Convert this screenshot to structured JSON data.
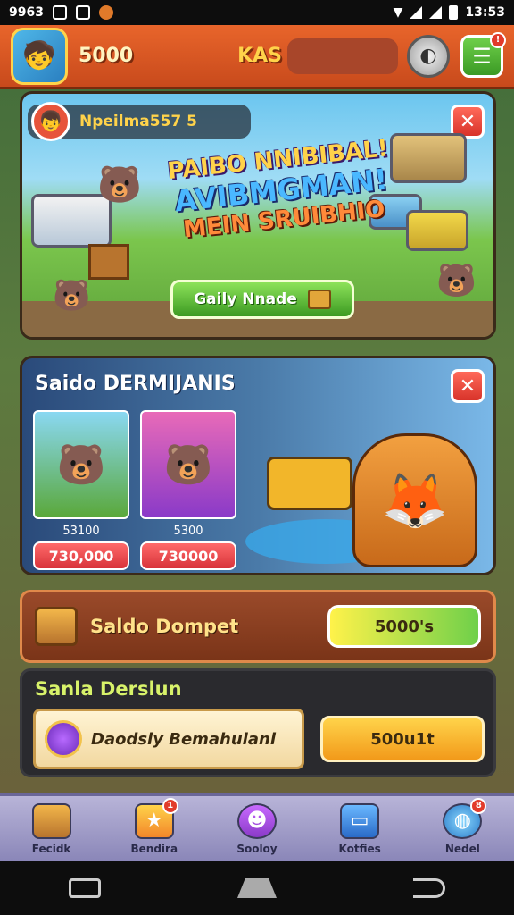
{
  "status_bar": {
    "left_text": "9963",
    "time": "13:53"
  },
  "topbar": {
    "coins": "5000",
    "kas": "KAS"
  },
  "banner": {
    "username": "Npeilma557 5",
    "headline": [
      "PAIBO NNIBIBAL!",
      "AVIBMGMAN!",
      "MEIN SRUIBHIO"
    ],
    "button_label": "Gaily Nnade"
  },
  "card2": {
    "title": "Saido DERMIJANIS",
    "items": [
      {
        "caption": "53100",
        "price": "730,000"
      },
      {
        "caption": "5300",
        "price": "730000"
      }
    ]
  },
  "wallet": {
    "label": "Saldo Dompet",
    "button_label": "5000's"
  },
  "deposit": {
    "title": "Sanla Derslun",
    "field_text": "Daodsiy Bemahulani",
    "button_label": "500u1t"
  },
  "bottom_nav": [
    {
      "label": "Fecidk",
      "icon": "chest-icon"
    },
    {
      "label": "Bendira",
      "icon": "star-icon"
    },
    {
      "label": "Sooloy",
      "icon": "monster-icon"
    },
    {
      "label": "Kotfies",
      "icon": "computer-icon"
    },
    {
      "label": "Nedel",
      "icon": "globe-icon"
    }
  ],
  "colors": {
    "accent": "#e8652b",
    "gold": "#ffd34a",
    "green": "#6fd04a",
    "red": "#d8333a"
  }
}
